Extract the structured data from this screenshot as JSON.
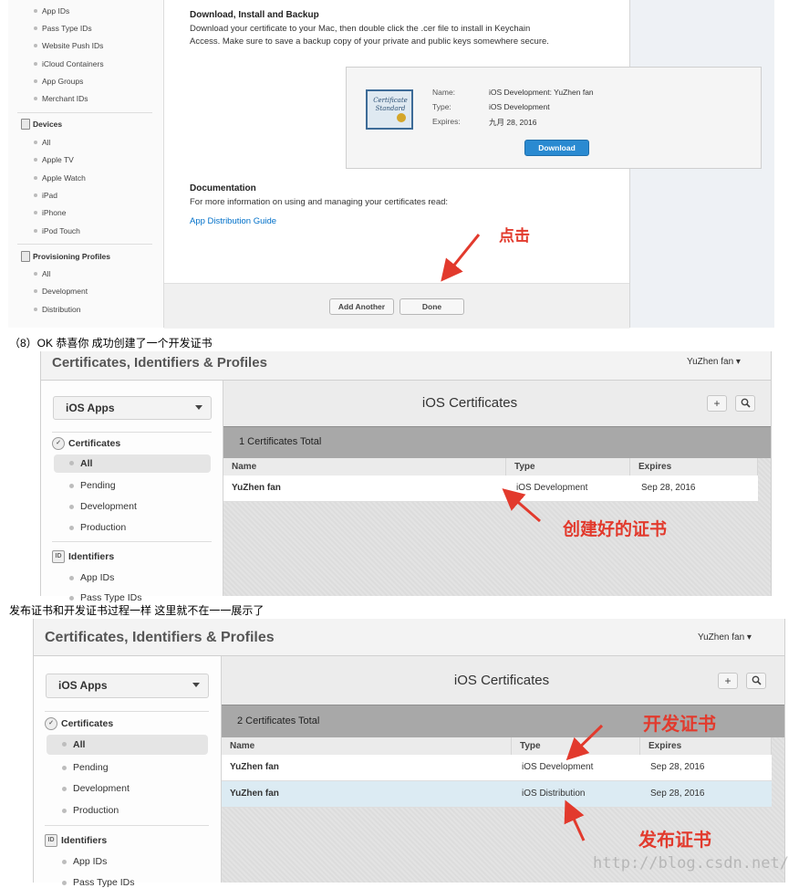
{
  "panel1": {
    "sidebar": {
      "id_items": [
        "App IDs",
        "Pass Type IDs",
        "Website Push IDs",
        "iCloud Containers",
        "App Groups",
        "Merchant IDs"
      ],
      "devices_header": "Devices",
      "device_items": [
        "All",
        "Apple TV",
        "Apple Watch",
        "iPad",
        "iPhone",
        "iPod Touch"
      ],
      "profiles_header": "Provisioning Profiles",
      "profile_items": [
        "All",
        "Development",
        "Distribution"
      ]
    },
    "download_heading": "Download, Install and Backup",
    "download_text_1": "Download your certificate to your Mac, then double click the .cer file to install in Keychain",
    "download_text_2": "Access. Make sure to save a backup copy of your private and public keys somewhere secure.",
    "certificate": {
      "image_text": "Certificate Standard",
      "name_label": "Name:",
      "name_value": "iOS Development: YuZhen fan",
      "type_label": "Type:",
      "type_value": "iOS Development",
      "expires_label": "Expires:",
      "expires_value": "九月 28, 2016",
      "download_button": "Download"
    },
    "doc_heading": "Documentation",
    "doc_text": "For more information on using and managing your certificates read:",
    "doc_link": "App Distribution Guide",
    "annotation": "点击",
    "add_another_button": "Add Another",
    "done_button": "Done"
  },
  "caption_1": "（8）OK 恭喜你 成功创建了一个开发证书",
  "caption_2": "发布证书和开发证书过程一样 这里就不在一一展示了",
  "panel2": {
    "header_title": "Certificates, Identifiers & Profiles",
    "user_menu": "YuZhen fan ▾",
    "platform_dropdown": "iOS Apps",
    "certificates_header": "Certificates",
    "cert_nav": [
      "All",
      "Pending",
      "Development",
      "Production"
    ],
    "identifiers_header": "Identifiers",
    "identifier_nav": [
      "App IDs",
      "Pass Type IDs"
    ],
    "main_title": "iOS Certificates",
    "add_icon": "+",
    "total_text": "1 Certificates Total",
    "columns": [
      "Name",
      "Type",
      "Expires"
    ],
    "rows": [
      {
        "name": "YuZhen fan",
        "type": "iOS Development",
        "expires": "Sep 28, 2016"
      }
    ],
    "annotation": "创建好的证书"
  },
  "panel3": {
    "header_title": "Certificates, Identifiers & Profiles",
    "user_menu": "YuZhen fan ▾",
    "platform_dropdown": "iOS Apps",
    "certificates_header": "Certificates",
    "cert_nav": [
      "All",
      "Pending",
      "Development",
      "Production"
    ],
    "identifiers_header": "Identifiers",
    "identifier_nav": [
      "App IDs",
      "Pass Type IDs"
    ],
    "main_title": "iOS Certificates",
    "add_icon": "+",
    "total_text": "2 Certificates Total",
    "columns": [
      "Name",
      "Type",
      "Expires"
    ],
    "rows": [
      {
        "name": "YuZhen fan",
        "type": "iOS Development",
        "expires": "Sep 28, 2016"
      },
      {
        "name": "YuZhen fan",
        "type": "iOS Distribution",
        "expires": "Sep 28, 2016"
      }
    ],
    "annotation_dev": "开发证书",
    "annotation_dist": "发布证书"
  },
  "watermark": "http://blog.csdn.net/",
  "colors": {
    "annotation": "#e23a2d",
    "link": "#0070c9",
    "download_button": "#2a8ad1",
    "selected_row": "#dcebf3"
  }
}
